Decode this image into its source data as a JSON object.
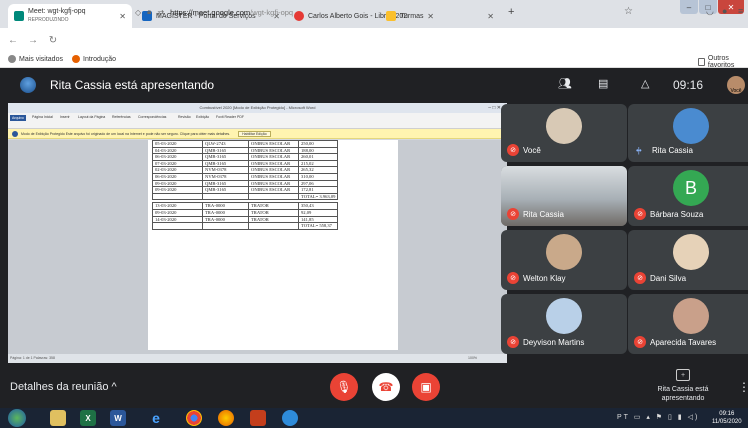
{
  "browser": {
    "tabs": [
      {
        "title": "Meet: wgt-kgfj-opq",
        "subtitle": "REPRODUZINDO",
        "color": "#00897b"
      },
      {
        "title": "MAGISTER - Portal de Serviços",
        "color": "#1565c0"
      },
      {
        "title": "Carlos Alberto Gois - Libras 202",
        "color": "#e53935"
      },
      {
        "title": "Turmas",
        "color": "#fbc02d"
      }
    ],
    "url_host": "https://meet.google.com",
    "url_path": "/wgt-kgfj-opq",
    "bookmarks": [
      "Mais visitados",
      "Introdução"
    ],
    "other_bookmarks": "Outros favoritos"
  },
  "meet": {
    "presenter_banner": "Rita Cassia está apresentando",
    "clock": "09:16",
    "self_label": "Você",
    "details_label": "Detalhes da reunião",
    "presenting_label": "Rita Cassia está apresentando",
    "participants": [
      {
        "name": "Você",
        "initial": "",
        "muted": true,
        "bg": "#3c4043"
      },
      {
        "name": "Rita Cassia",
        "initial": "",
        "muted": false,
        "bg": "#3c4043"
      },
      {
        "name": "Rita Cassia",
        "initial": "",
        "muted": true,
        "bg": "#5b5f62"
      },
      {
        "name": "Bárbara Souza",
        "initial": "B",
        "muted": true,
        "bg": "#3c4043"
      },
      {
        "name": "Welton Klay",
        "initial": "",
        "muted": true,
        "bg": "#3c4043"
      },
      {
        "name": "Dani Silva",
        "initial": "",
        "muted": true,
        "bg": "#3c4043"
      },
      {
        "name": "Deyvison Martins",
        "initial": "",
        "muted": true,
        "bg": "#3c4043"
      },
      {
        "name": "Aparecida Tavares",
        "initial": "",
        "muted": true,
        "bg": "#3c4043"
      }
    ]
  },
  "word": {
    "title": "Combustível 2020 [Modo de Exibição Protegido] - Microsoft Word",
    "ribbon_tabs": [
      "Arquivo",
      "Página Inicial",
      "Inserir",
      "Layout da Página",
      "Referências",
      "Correspondências",
      "Revisão",
      "Exibição",
      "Foxit Reader PDF"
    ],
    "protected_msg": "Modo de Exibição Protegido   Este arquivo foi originado de um local na Internet e pode não ser seguro. Clique para obter mais detalhes.",
    "protected_btn": "Habilitar Edição",
    "status": "Página: 1 de 1   Palavras: 358",
    "zoom": "100%",
    "table": [
      [
        "05-03-2020",
        "QLW-2743",
        "ONIBUS ESCOLAR",
        "250,00"
      ],
      [
        "04-03-2020",
        "QMB-3165",
        "ONIBUS ESCOLAR",
        "188,00"
      ],
      [
        "06-03-2020",
        "QMB-3165",
        "ONIBUS ESCOLAR",
        "260,01"
      ],
      [
        "07-03-2020",
        "QMB-3165",
        "ONIBUS ESCOLAR",
        "215,02"
      ],
      [
        "02-03-2020",
        "NVM-0378",
        "ONIBUS ESCOLAR",
        "265,32"
      ],
      [
        "06-03-2020",
        "NVM-0378",
        "ONIBUS ESCOLAR",
        "310,00"
      ],
      [
        "09-03-2020",
        "QMB-3165",
        "ONIBUS ESCOLAR",
        "297,06"
      ],
      [
        "09-03-2020",
        "QMB-3165",
        "ONIBUS ESCOLAR",
        "172,81"
      ],
      [
        "",
        "",
        "",
        "TOTAL= 3.963,09"
      ],
      [
        "13-03-2020",
        "TRA-0000",
        "TRATOR",
        "350,43"
      ],
      [
        "09-03-2020",
        "TRA-0000",
        "TRATOR",
        "92,09"
      ],
      [
        "14-03-2020",
        "TRA-0000",
        "TRATOR",
        "141,85"
      ],
      [
        "",
        "",
        "",
        "TOTAL= 558,37"
      ]
    ]
  },
  "taskbar": {
    "time": "09:16",
    "date": "11/05/2020",
    "lang": "PT"
  }
}
